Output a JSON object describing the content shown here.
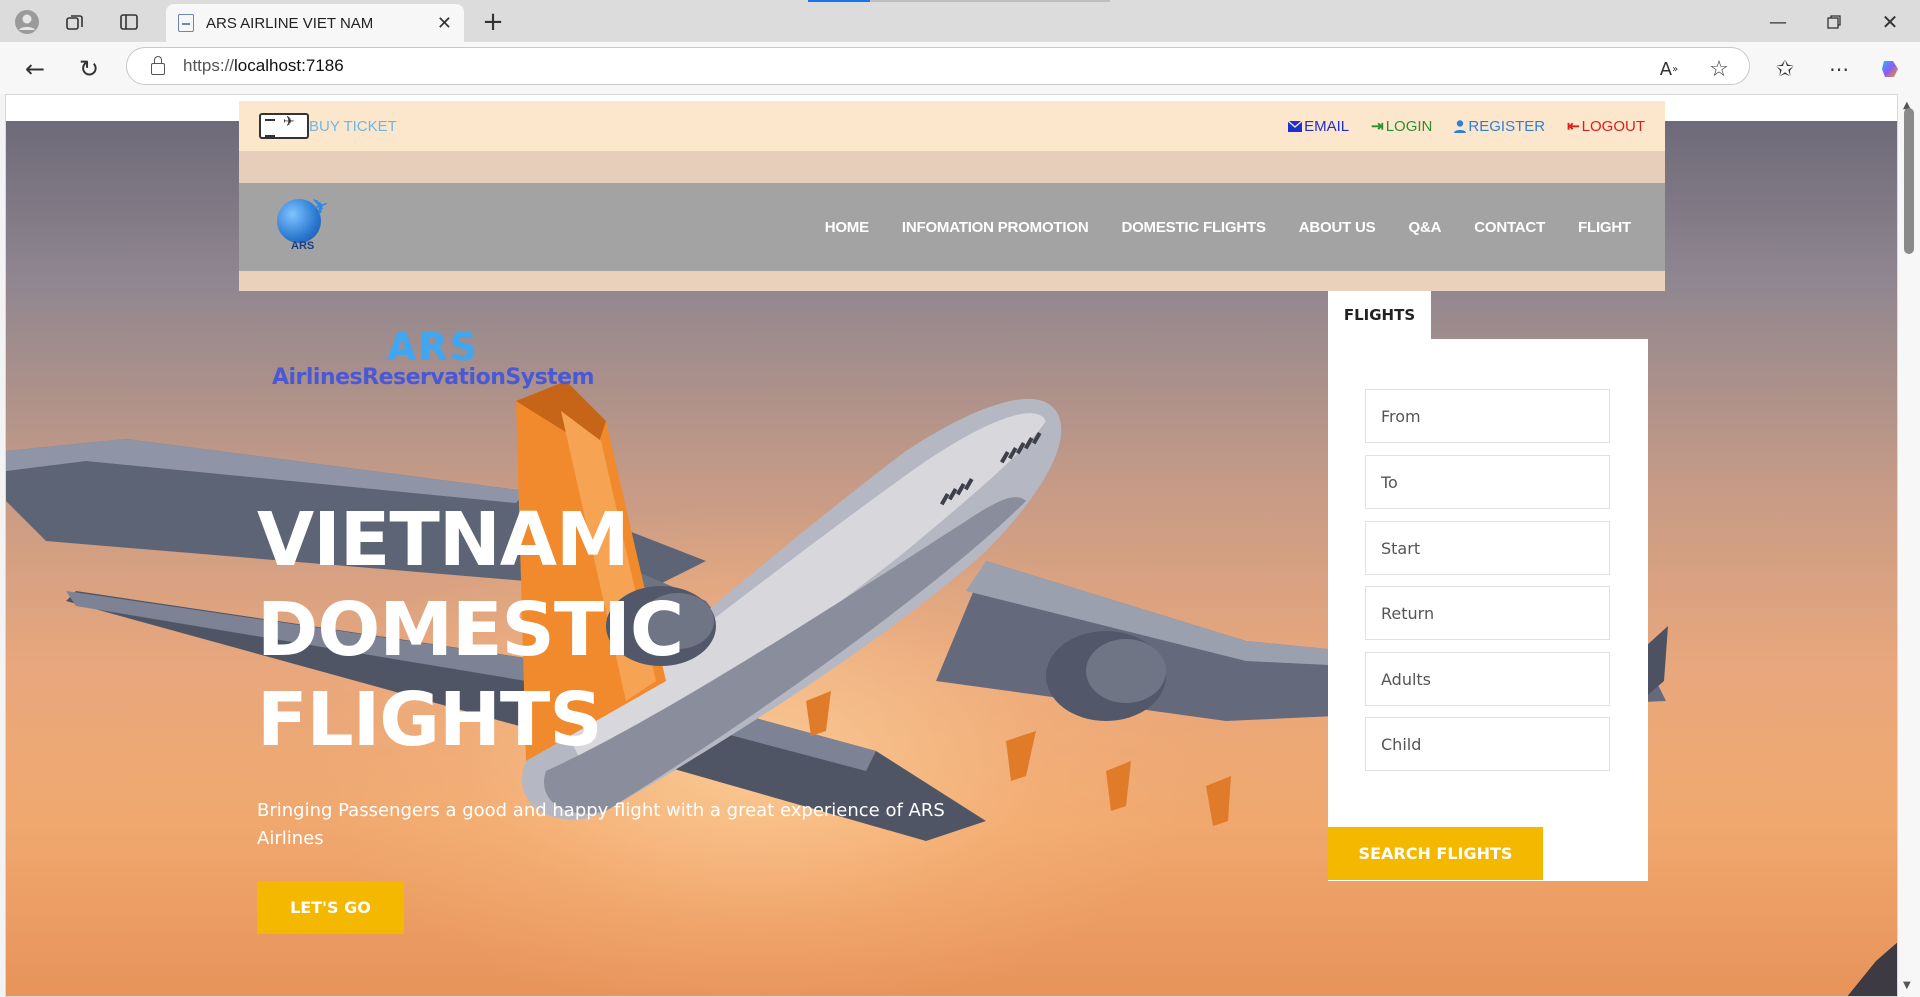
{
  "browser": {
    "tab_title": "ARS AIRLINE VIET NAM",
    "url_prefix": "https://",
    "url_host": "localhost:7186"
  },
  "topbar": {
    "buy_ticket": "BUY TICKET",
    "links": {
      "email": "EMAIL",
      "login": "LOGIN",
      "register": "REGISTER",
      "logout": "LOGOUT"
    }
  },
  "nav": {
    "logo_text": "ARS",
    "items": [
      "HOME",
      "INFOMATION PROMOTION",
      "DOMESTIC FLIGHTS",
      "ABOUT US",
      "Q&A",
      "CONTACT",
      "FLIGHT"
    ]
  },
  "hero": {
    "brand_short": "ARS",
    "brand_full": "AirlinesReservationSystem",
    "headline_line1": "VIETNAM",
    "headline_line2": "DOMESTIC",
    "headline_line3": "FLIGHTS",
    "subline": "Bringing Passengers a good and happy flight with a great experience of ARS Airlines",
    "cta": "LET'S GO"
  },
  "search": {
    "tab_label": "FLIGHTS",
    "from_placeholder": "From",
    "to_placeholder": "To",
    "start_placeholder": "Start",
    "return_placeholder": "Return",
    "adults_placeholder": "Adults",
    "child_placeholder": "Child",
    "submit": "SEARCH FLIGHTS"
  },
  "colors": {
    "accent": "#f5b800",
    "topbar_bg": "#fde7cc",
    "nav_bg": "#a3a3a3",
    "email": "#1d2fd0",
    "login": "#2f8f2f",
    "register": "#2f7fd8",
    "logout": "#d92020"
  },
  "icons": {
    "ticket": "ticket-icon",
    "email": "envelope-icon",
    "login": "sign-in-icon",
    "register": "user-icon",
    "logout": "sign-out-icon"
  }
}
